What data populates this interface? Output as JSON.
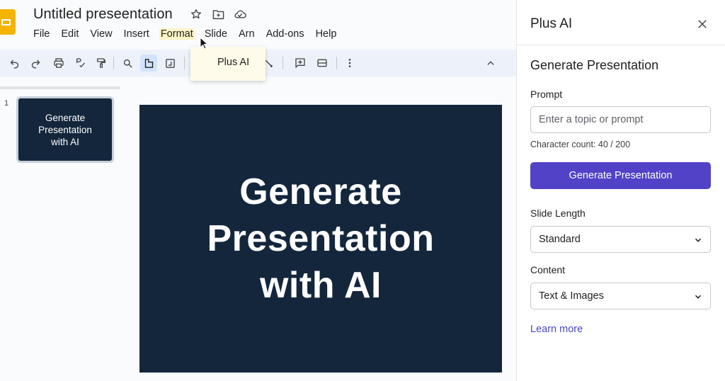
{
  "app": {
    "title": "Untitled preseentation",
    "menu": [
      "File",
      "Edit",
      "View",
      "Insert",
      "Format",
      "Slide",
      "Arn",
      "Add-ons",
      "Help"
    ],
    "dropdown_item": "Plus AI"
  },
  "filmstrip": {
    "slide_number": "1",
    "thumb_text": "Generate\nPresentation\nwith AI"
  },
  "slide": {
    "text": "Generate\nPresentation\nwith AI"
  },
  "panel": {
    "title": "Plus AI",
    "section_title": "Generate Presentation",
    "prompt_label": "Prompt",
    "prompt_placeholder": "Enter a topic or prompt",
    "prompt_value": "",
    "char_count": "Character count: 40 / 200",
    "generate_button": "Generate Presentation",
    "slide_length_label": "Slide Length",
    "slide_length_value": "Standard",
    "content_label": "Content",
    "content_value": "Text & Images",
    "learn_more": "Learn more"
  },
  "colors": {
    "slide_bg": "#13263c",
    "accent_button": "#5142c7",
    "link": "#4b46c8",
    "logo": "#f4b400"
  },
  "icons": {
    "title_bar": [
      "star-icon",
      "move-to-folder-icon",
      "cloud-status-icon"
    ],
    "toolbar": [
      "undo-icon",
      "redo-icon",
      "print-icon",
      "spellcheck-icon",
      "paint-format-icon",
      "zoom-icon",
      "select-icon",
      "image-icon",
      "line-icon",
      "comment-icon",
      "layout-icon",
      "more-icon",
      "collapse-icon"
    ]
  }
}
